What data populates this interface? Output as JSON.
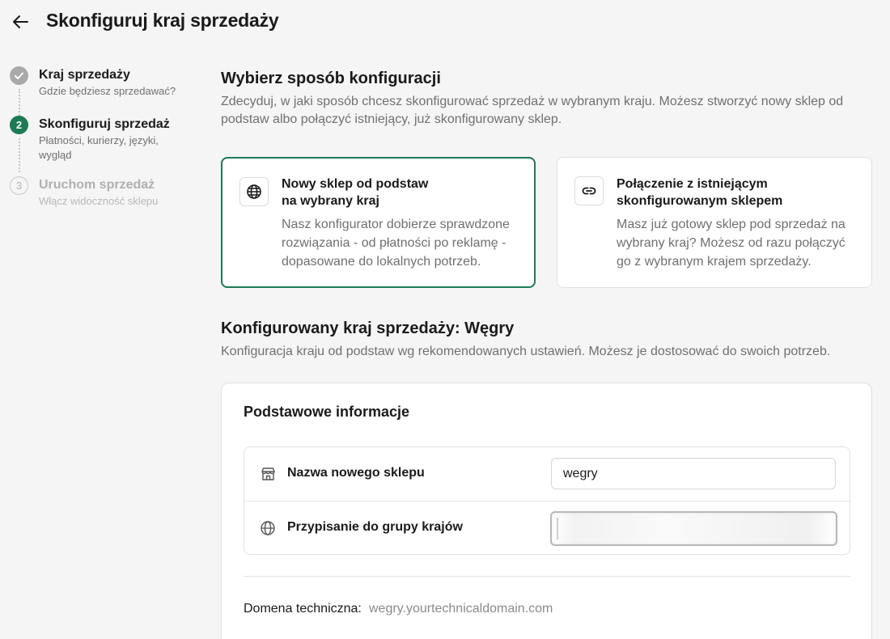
{
  "header": {
    "title": "Skonfiguruj kraj sprzedaży",
    "back_icon": "arrow-left-icon"
  },
  "stepper": {
    "steps": [
      {
        "number": "✓",
        "title": "Kraj sprzedaży",
        "subtitle": "Gdzie będziesz sprzedawać?",
        "state": "done"
      },
      {
        "number": "2",
        "title": "Skonfiguruj sprzedaż",
        "subtitle": "Płatności, kurierzy, języki, wygląd",
        "state": "active"
      },
      {
        "number": "3",
        "title": "Uruchom sprzedaż",
        "subtitle": "Włącz widoczność sklepu",
        "state": "todo"
      }
    ]
  },
  "config_method": {
    "title": "Wybierz sposób konfiguracji",
    "description": "Zdecyduj, w jaki sposób chcesz skonfigurować sprzedaż w wybranym kraju. Możesz stworzyć nowy sklep od podstaw albo połączyć istniejący, już skonfigurowany sklep.",
    "options": [
      {
        "title_line1": "Nowy sklep od podstaw",
        "title_line2": "na wybrany kraj",
        "desc_line1": "Nasz konfigurator dobierze sprawdzone",
        "desc_line2": "rozwiązania - od płatności po reklamę -",
        "desc_line3": "dopasowane do lokalnych potrzeb.",
        "icon": "globe-icon",
        "selected": true
      },
      {
        "title_line1": "Połączenie z istniejącym",
        "title_line2": "skonfigurowanym sklepem",
        "desc_line1": "Masz już gotowy sklep pod sprzedaż na",
        "desc_line2": "wybrany kraj? Możesz od razu połączyć",
        "desc_line3": "go z wybranym krajem sprzedaży.",
        "icon": "link-icon",
        "selected": false
      }
    ]
  },
  "country_config": {
    "title": "Konfigurowany kraj sprzedaży: Węgry",
    "description": "Konfiguracja kraju od podstaw wg rekomendowanych ustawień. Możesz je dostosować do swoich potrzeb."
  },
  "basic_info": {
    "title": "Podstawowe informacje",
    "fields": {
      "shop_name_label": "Nazwa nowego sklepu",
      "shop_name_value": "wegry",
      "shop_name_icon": "store-icon",
      "country_group_label": "Przypisanie do grupy krajów",
      "country_group_icon": "globe-icon"
    },
    "domain_label": "Domena techniczna:",
    "domain_value": "wegry.yourtechnicaldomain.com"
  },
  "colors": {
    "accent": "#1c7a55",
    "background": "#f5f5f5",
    "muted_text": "#707070"
  }
}
